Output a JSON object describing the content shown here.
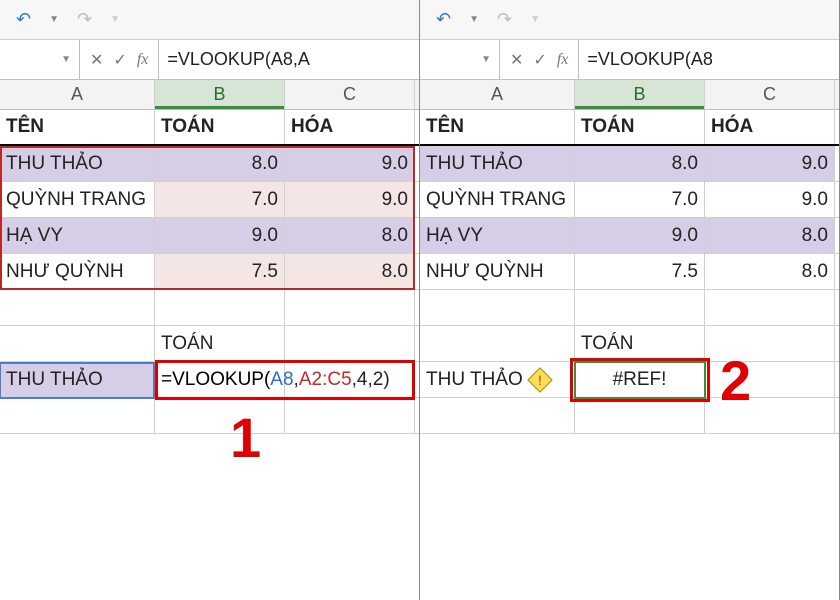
{
  "panes": [
    {
      "formula_bar": "=VLOOKUP(A8,A",
      "columns": [
        "A",
        "B",
        "C"
      ],
      "selected_col": "B",
      "headers": [
        "TÊN",
        "TOÁN",
        "HÓA"
      ],
      "rows": [
        {
          "name": "THU THẢO",
          "toan": "8.0",
          "hoa": "9.0",
          "style": "purple"
        },
        {
          "name": "QUỲNH TRANG",
          "toan": "7.0",
          "hoa": "9.0",
          "style": "pink"
        },
        {
          "name": "HẠ VY",
          "toan": "9.0",
          "hoa": "8.0",
          "style": "purple"
        },
        {
          "name": "NHƯ QUỲNH",
          "toan": "7.5",
          "hoa": "8.0",
          "style": "pink"
        }
      ],
      "label_toan": "TOÁN",
      "lookup_name": "THU THẢO",
      "lookup_cell": "=VLOOKUP(A8,A2:C5,4,2)",
      "lookup_cell_parts": {
        "pre": "=VLOOKUP(",
        "a": "A8",
        "c1": ",",
        "r": "A2:C5",
        "c2": ",",
        "rest": "4,2)"
      },
      "annotation": "1"
    },
    {
      "formula_bar": "=VLOOKUP(A8",
      "columns": [
        "A",
        "B",
        "C"
      ],
      "selected_col": "B",
      "headers": [
        "TÊN",
        "TOÁN",
        "HÓA"
      ],
      "rows": [
        {
          "name": "THU THẢO",
          "toan": "8.0",
          "hoa": "9.0",
          "style": "purple"
        },
        {
          "name": "QUỲNH TRANG",
          "toan": "7.0",
          "hoa": "9.0",
          "style": ""
        },
        {
          "name": "HẠ VY",
          "toan": "9.0",
          "hoa": "8.0",
          "style": "purple"
        },
        {
          "name": "NHƯ QUỲNH",
          "toan": "7.5",
          "hoa": "8.0",
          "style": ""
        }
      ],
      "label_toan": "TOÁN",
      "lookup_name": "THU THẢO",
      "lookup_cell": "#REF!",
      "annotation": "2"
    }
  ]
}
